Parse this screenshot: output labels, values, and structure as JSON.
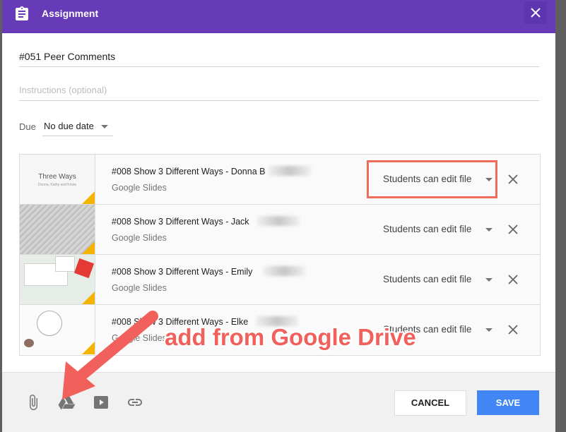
{
  "dialog": {
    "title": "Assignment",
    "icons": {
      "title": "clipboard-icon",
      "close": "close-icon"
    },
    "colors": {
      "header": "#673ab7",
      "save": "#4285f4",
      "highlight": "#ef6b5b",
      "annotation": "#f1605a"
    }
  },
  "form": {
    "title_value": "#051 Peer Comments",
    "instructions_placeholder": "Instructions (optional)",
    "due_label": "Due",
    "due_value": "No due date"
  },
  "attachments": [
    {
      "name": "#008 Show 3 Different Ways - Donna B",
      "type": "Google Slides",
      "permission": "Students can edit file",
      "thumb_title": "Three Ways",
      "thumb_subtitle": "Donna, Kathy and Krista"
    },
    {
      "name": "#008 Show 3 Different Ways - Jack",
      "type": "Google Slides",
      "permission": "Students can edit file"
    },
    {
      "name": "#008 Show 3 Different Ways - Emily",
      "type": "Google Slides",
      "permission": "Students can edit file"
    },
    {
      "name": "#008 Show 3 Different Ways - Elke",
      "type": "Google Slides",
      "permission": "Students can edit file"
    }
  ],
  "footer": {
    "icons": [
      "paperclip-icon",
      "google-drive-icon",
      "youtube-icon",
      "link-icon"
    ],
    "cancel_label": "CANCEL",
    "save_label": "SAVE"
  },
  "annotation": {
    "text": "add from Google Drive"
  }
}
